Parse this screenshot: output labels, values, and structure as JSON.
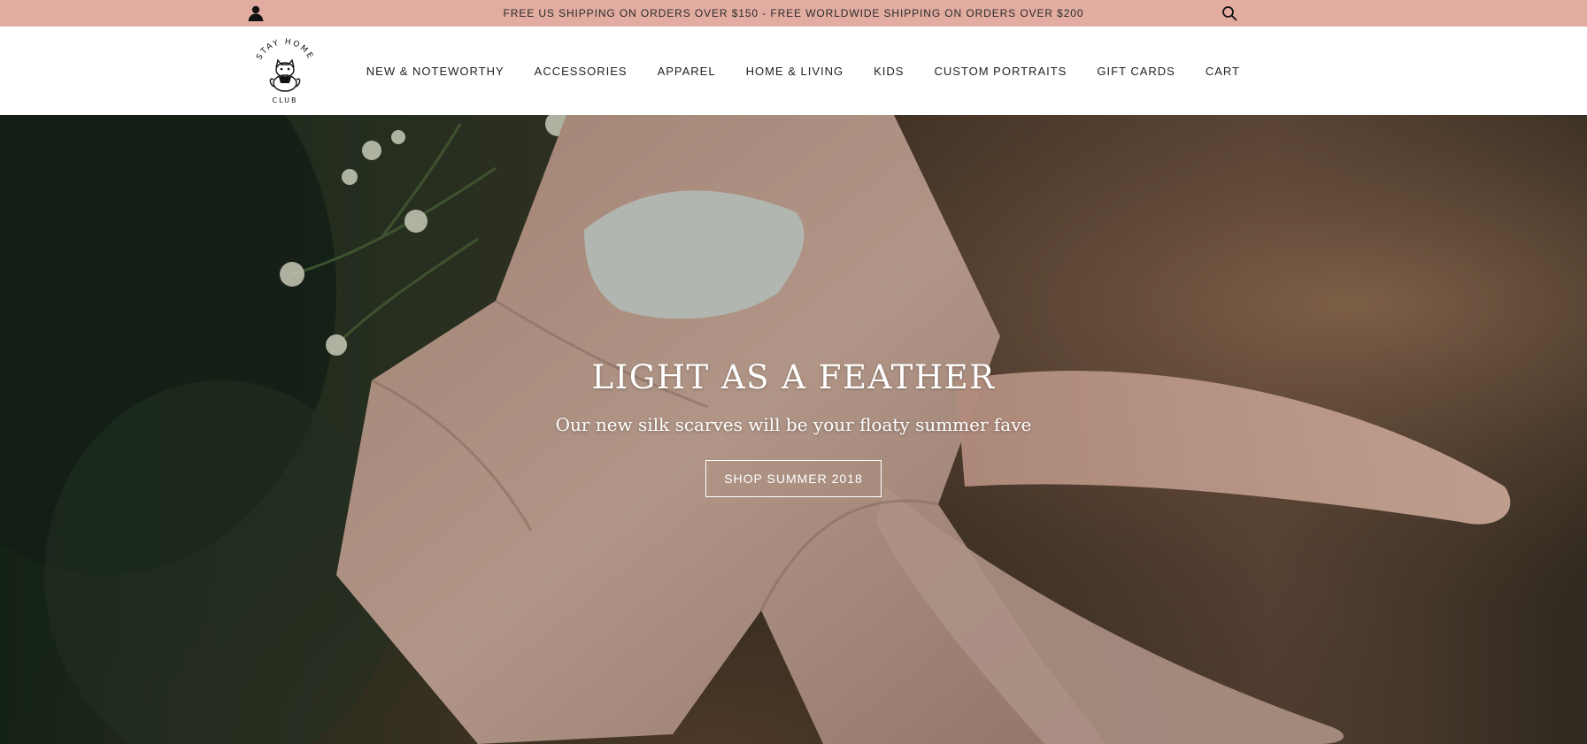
{
  "announcement": {
    "text": "FREE US SHIPPING ON ORDERS OVER $150 - FREE WORLDWIDE SHIPPING ON ORDERS OVER $200",
    "account_icon": "account-icon",
    "search_icon": "search-icon"
  },
  "logo": {
    "text_top": "STAY HOME",
    "text_bottom": "CLUB"
  },
  "nav": {
    "items": [
      "NEW & NOTEWORTHY",
      "ACCESSORIES",
      "APPAREL",
      "HOME & LIVING",
      "KIDS",
      "CUSTOM PORTRAITS",
      "GIFT CARDS",
      "CART"
    ]
  },
  "hero": {
    "title": "LIGHT AS A FEATHER",
    "subtitle": "Our new silk scarves will be your floaty summer fave",
    "button_label": "SHOP SUMMER 2018"
  },
  "colors": {
    "announcement_bg": "#e2ada0",
    "header_bg": "#ffffff",
    "text": "#222222",
    "hero_text": "#ffffff"
  }
}
